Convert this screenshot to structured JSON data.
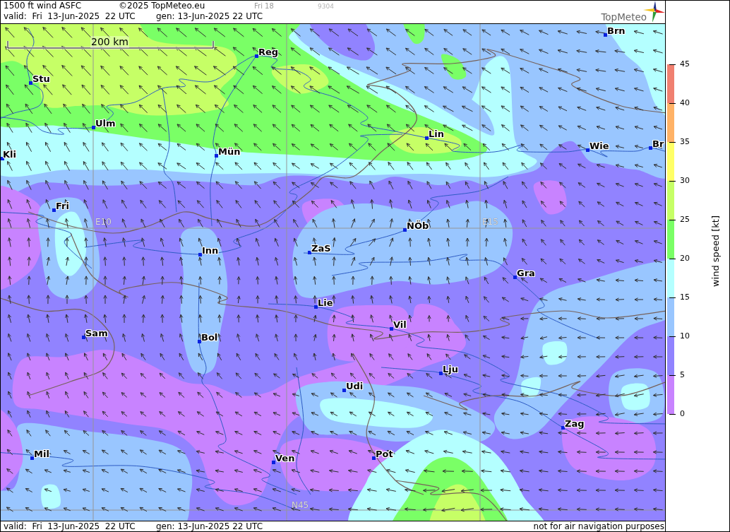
{
  "header": {
    "title": "1500 ft wind ASFC",
    "copyright": "©2025 TopMeteo.eu",
    "run": "Fri 18",
    "code": "9304",
    "valid": "valid:  Fri  13-Jun-2025  22 UTC",
    "generated": "gen: 13-Jun-2025 22 UTC",
    "logo": "TopMeteo"
  },
  "map": {
    "scale": "200 km",
    "grid_labels": [
      "E10",
      "E15",
      "N45"
    ],
    "cities": [
      "Brn",
      "Reg",
      "Stu",
      "Ulm",
      "Lin",
      "Br",
      "Wie",
      "Mün",
      "Kli",
      "Fri",
      "NÖb",
      "ZaS",
      "Inn",
      "Gra",
      "Lie",
      "Vil",
      "Sam",
      "Bol",
      "Lju",
      "Udi",
      "Zag",
      "Mil",
      "Pot",
      "Ven"
    ]
  },
  "legend": {
    "title": "wind speed [kt]",
    "bands": [
      {
        "color": "#f08070"
      },
      {
        "color": "#ffb266"
      },
      {
        "color": "#ffff66"
      },
      {
        "color": "#c6ff66"
      },
      {
        "color": "#7aff66"
      },
      {
        "color": "#b4ffff"
      },
      {
        "color": "#99c6ff"
      },
      {
        "color": "#9183ff"
      },
      {
        "color": "#c883ff"
      }
    ],
    "ticks": [
      "45",
      "40",
      "35",
      "30",
      "25",
      "20",
      "15",
      "10",
      "5",
      "0"
    ]
  },
  "footer": {
    "valid": "valid:  Fri  13-Jun-2025  22 UTC",
    "generated": "gen: 13-Jun-2025 22 UTC",
    "disclaimer": "not for air navigation purposes"
  }
}
